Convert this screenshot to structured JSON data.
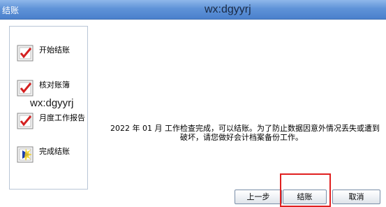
{
  "window": {
    "title": "结账"
  },
  "watermark": "wx:dgyyrj",
  "steps": [
    {
      "label": "开始结账",
      "icon": "checked-step-icon"
    },
    {
      "label": "核对账簿",
      "icon": "checked-step-icon"
    },
    {
      "label": "月度工作报告",
      "icon": "checked-step-icon"
    },
    {
      "label": "完成结账",
      "icon": "finish-step-icon"
    }
  ],
  "message": {
    "line1": "2022 年 01 月  工作检查完成，可以结账。为了防止数据因意外情况丢失或遭到",
    "line2": "破坏，请您做好会计档案备份工作。"
  },
  "buttons": {
    "prev": "上一步",
    "close": "结账",
    "cancel": "取消"
  },
  "colors": {
    "titlebar": "#5f93d8",
    "check": "#d42020",
    "highlight": "#e02020"
  }
}
